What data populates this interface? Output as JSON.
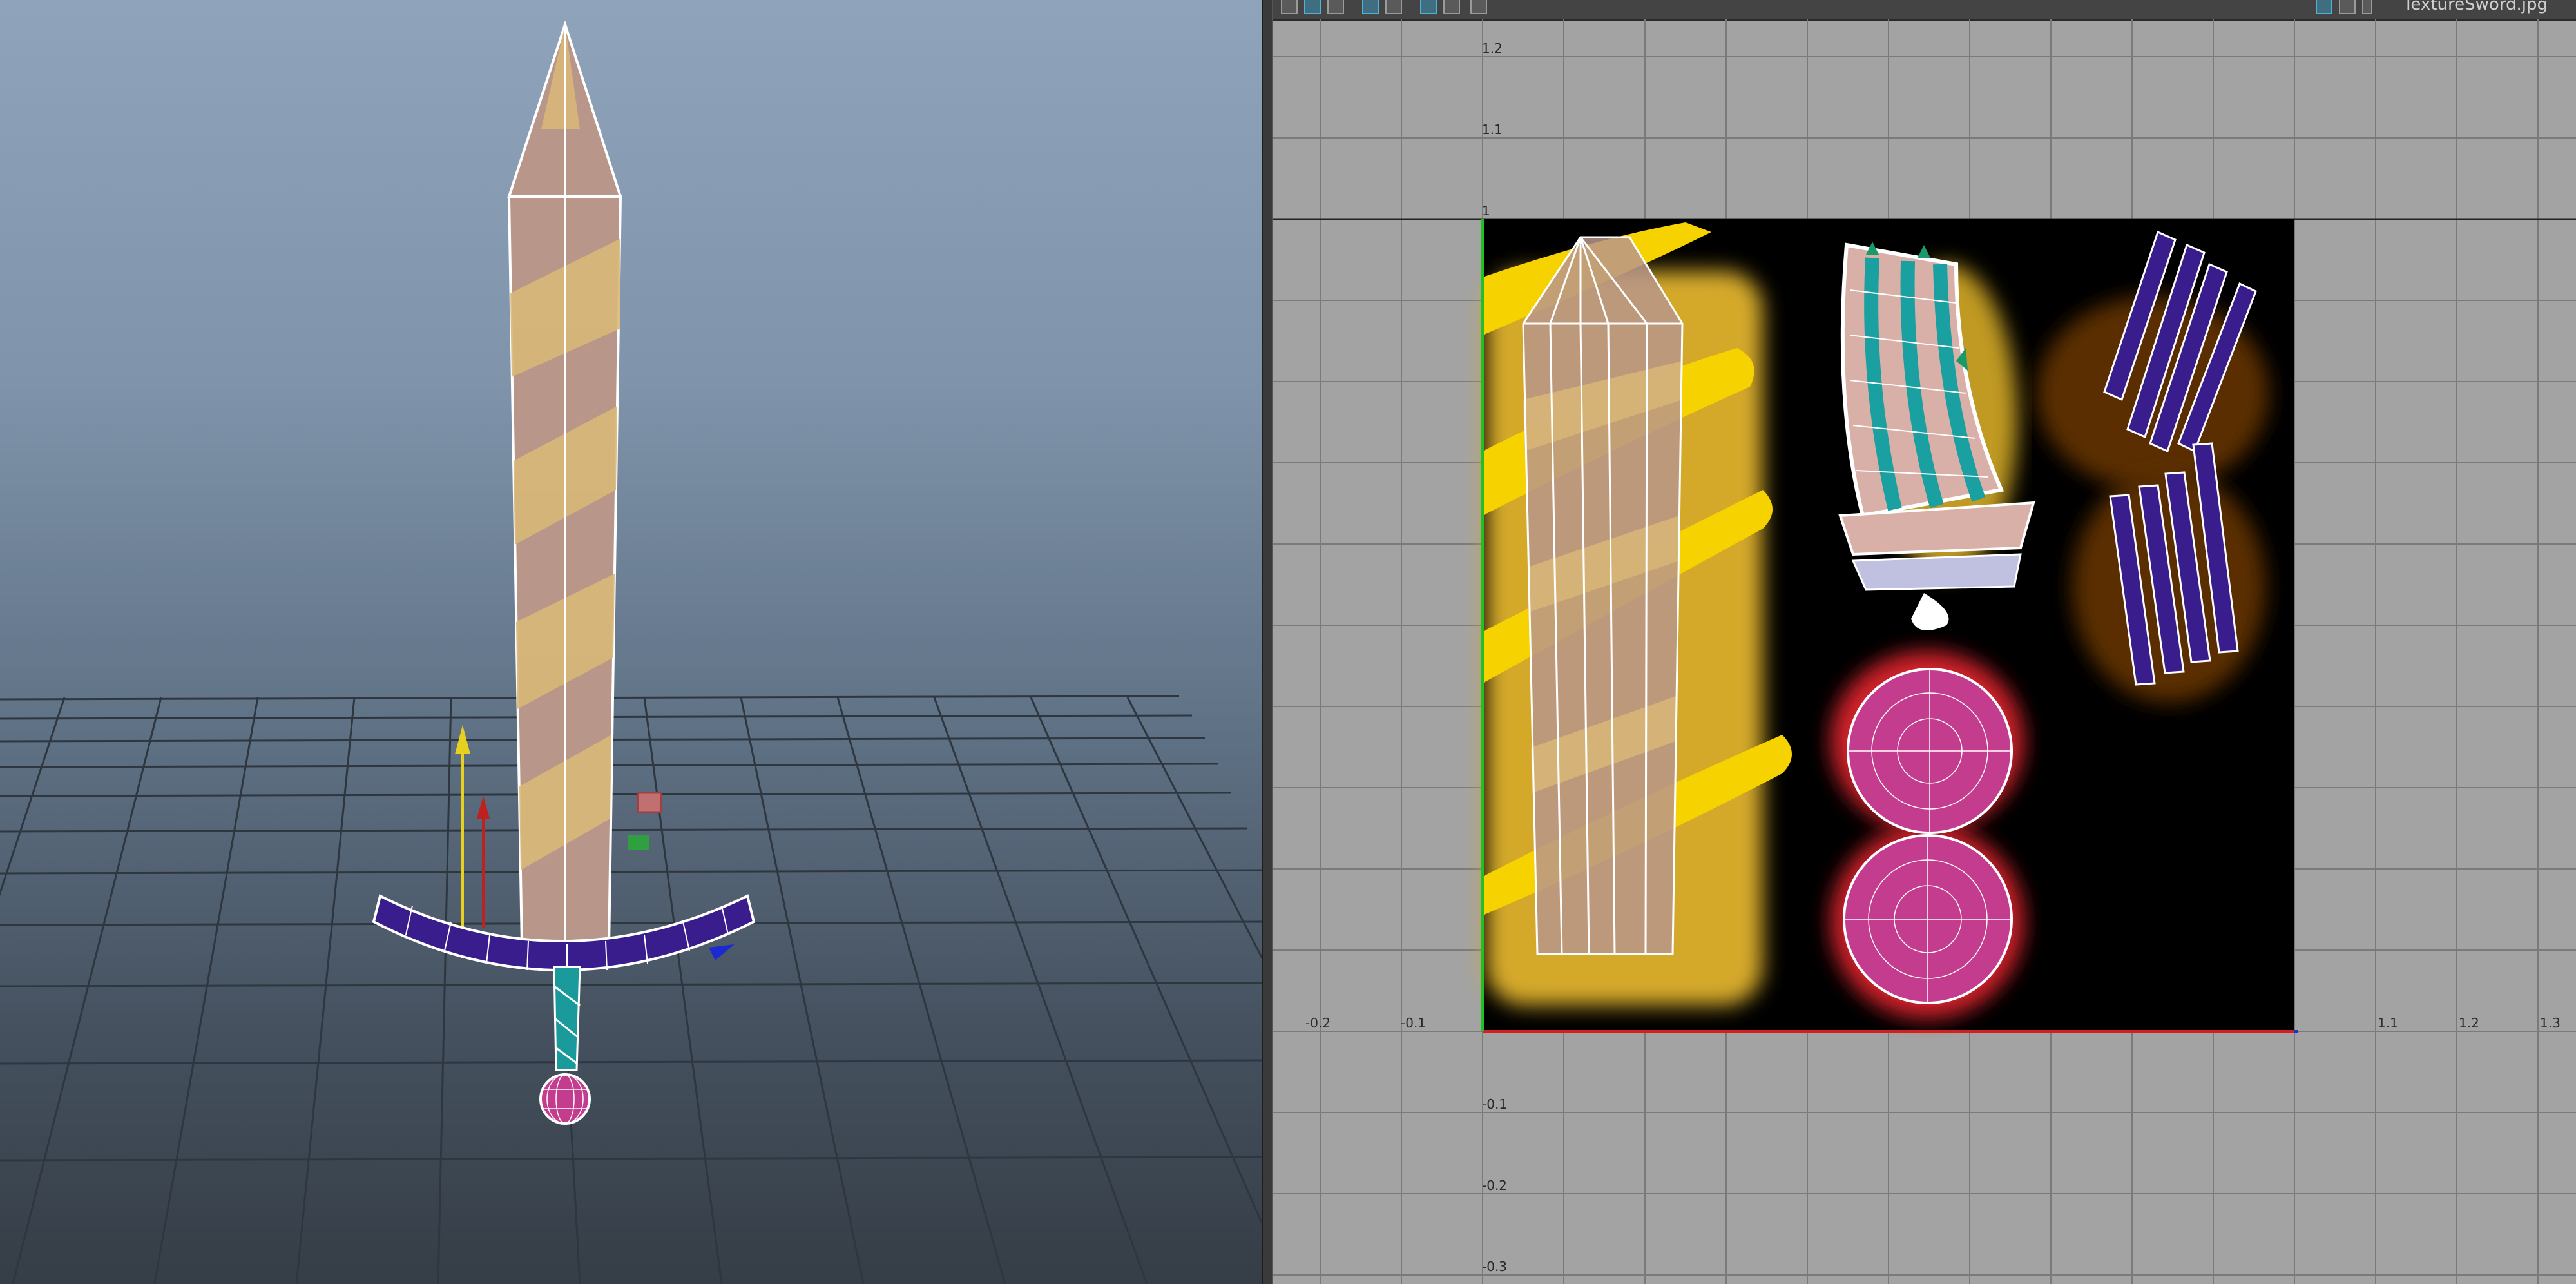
{
  "viewport": {
    "name": "perspective-viewport",
    "sky_top": "#8fa3bb",
    "sky_bottom": "#353d46",
    "grid_color": "#2e3640"
  },
  "model": {
    "blade_color": "#b8968a",
    "stripe_color": "#d9b878",
    "guard_color": "#3a1d8c",
    "grip_color": "#1a9a9a",
    "pommel_color": "#c43c8e"
  },
  "uv_editor": {
    "toolbar": {
      "icons": [
        "grid-icon",
        "uv-shell-icon",
        "image-icon",
        "shaded-uv-icon",
        "checker-icon",
        "frame-icon",
        "isolate-icon",
        "snapshot-icon",
        "texture-icon",
        "checker-map-icon",
        "dropdown-icon"
      ],
      "texture_file": "TextureSword.jpg"
    },
    "u_axis_labels": [
      "-0.2",
      "-0.1",
      "1.1",
      "1.2",
      "1.3"
    ],
    "v_axis_labels": [
      "1.2",
      "1.1",
      "1",
      "-0.1",
      "-0.2",
      "-0.3"
    ],
    "colors": {
      "background": "#a3a3a3",
      "texture_bg": "#000000",
      "yellow": "#f5d200",
      "gold": "#d4a92a",
      "red": "#d0202a",
      "brown": "#5a2e05",
      "uv_line": "#ffffff",
      "u_axis": "#d02020",
      "v_axis": "#20c020"
    }
  }
}
